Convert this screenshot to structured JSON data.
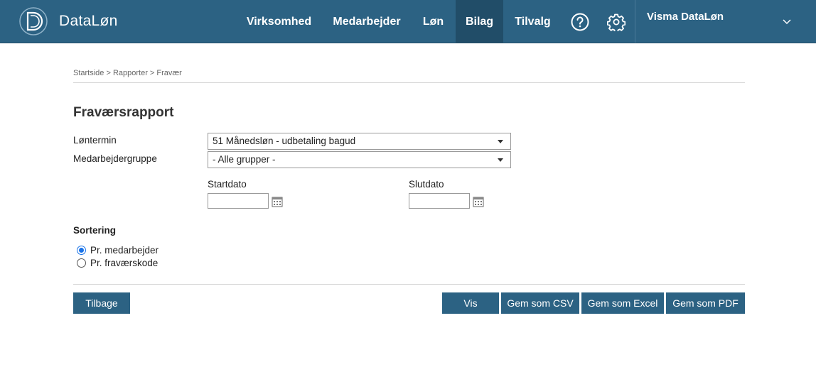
{
  "header": {
    "brand": "DataLøn",
    "nav": [
      {
        "label": "Virksomhed"
      },
      {
        "label": "Medarbejder"
      },
      {
        "label": "Løn"
      },
      {
        "label": "Bilag"
      },
      {
        "label": "Tilvalg"
      }
    ],
    "active_nav": "Bilag",
    "company": "Visma DataLøn",
    "icons": [
      "help-icon",
      "gear-icon",
      "chevron-down-icon"
    ]
  },
  "breadcrumb": "Startside > Rapporter > Fravær",
  "page_title": "Fraværsrapport",
  "form": {
    "loentermin_label": "Løntermin",
    "loentermin_value": "51 Månedsløn - udbetaling bagud",
    "gruppe_label": "Medarbejdergruppe",
    "gruppe_value": "- Alle grupper -",
    "startdato_label": "Startdato",
    "startdato_value": "",
    "slutdato_label": "Slutdato",
    "slutdato_value": ""
  },
  "sorting": {
    "label": "Sortering",
    "options": [
      {
        "label": "Pr. medarbejder",
        "checked": true
      },
      {
        "label": "Pr. fraværskode",
        "checked": false
      }
    ]
  },
  "buttons": {
    "back": "Tilbage",
    "show": "Vis",
    "csv": "Gem som CSV",
    "excel": "Gem som Excel",
    "pdf": "Gem som PDF"
  },
  "colors": {
    "primary": "#2c6283",
    "active_nav": "#214d68",
    "radio_accent": "#1a73e8"
  }
}
